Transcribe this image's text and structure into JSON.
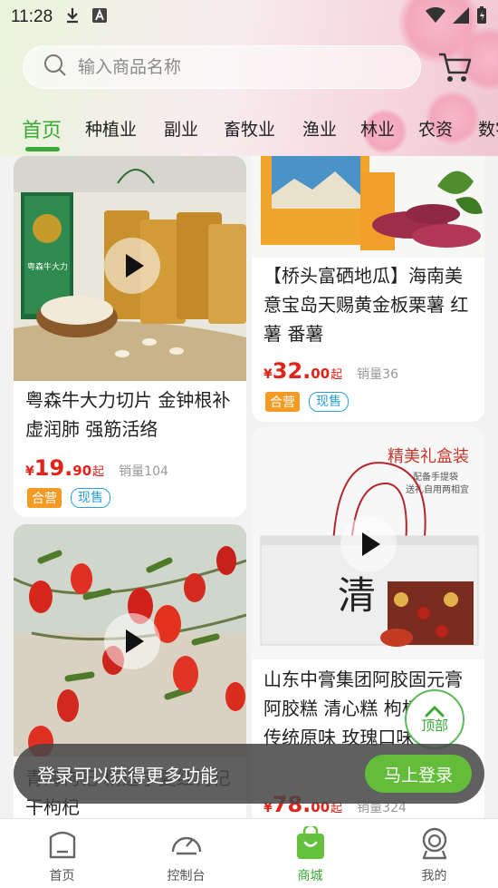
{
  "status_bar": {
    "time": "11:28"
  },
  "search": {
    "placeholder": "输入商品名称"
  },
  "categories": [
    "首页",
    "种植业",
    "副业",
    "畜牧业",
    "渔业",
    "林业",
    "农资",
    "数字"
  ],
  "products": [
    {
      "title": "粤森牛大力切片 金钟根补虚润肺 强筋活络",
      "price_symbol": "¥",
      "price_int": "19.",
      "price_dec": "90",
      "price_suffix": "起",
      "sales": "销量104",
      "badges": [
        "合营",
        "现售"
      ],
      "package_text": "粤森牛大力"
    },
    {
      "title": "【桥头富硒地瓜】海南美意宝岛天赐黄金板栗薯 红薯 番薯",
      "price_symbol": "¥",
      "price_int": "32.",
      "price_dec": "00",
      "price_suffix": "起",
      "sales": "销量36",
      "badges": [
        "合营",
        "现售"
      ]
    },
    {
      "title": "青海枸杞 精选宁夏红枸杞 干枸杞",
      "price_symbol": "¥",
      "price_int": "",
      "price_dec": "",
      "price_suffix": "",
      "sales": ""
    },
    {
      "title": "山东中膏集团阿胶固元膏 阿胶糕 清心糕 枸杞口味 传统原味 玫瑰口味",
      "price_symbol": "¥",
      "price_int": "78.",
      "price_dec": "00",
      "price_suffix": "起",
      "sales": "销量324",
      "banner": "精美礼盒装",
      "banner_sub1": "配备手提袋",
      "banner_sub2": "送礼自用两相宜",
      "box_char": "清"
    }
  ],
  "login_prompt": {
    "text": "登录可以获得更多功能",
    "button": "马上登录"
  },
  "back_to_top": {
    "label": "顶部"
  },
  "bottom_nav": [
    "首页",
    "控制台",
    "商城",
    "我的"
  ],
  "colors": {
    "accent_green": "#3aaa35",
    "price_red": "#e2231a",
    "badge_orange": "#f59a23",
    "badge_blue": "#2a9fd6"
  }
}
